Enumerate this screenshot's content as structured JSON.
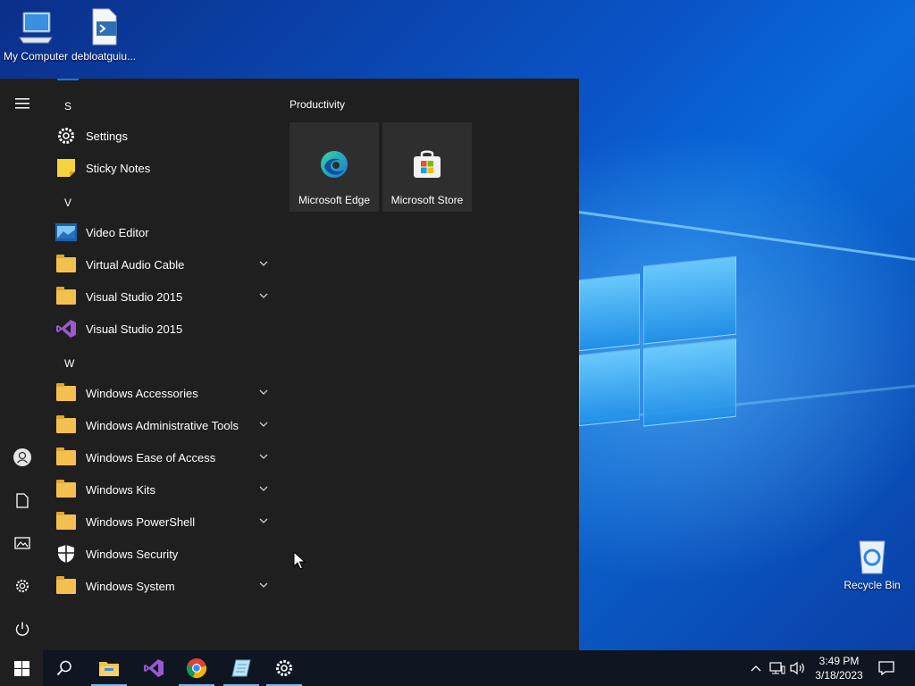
{
  "desktop": {
    "icons": [
      {
        "label": "My Computer"
      },
      {
        "label": "debloatguiu..."
      },
      {
        "label": "Recycle Bin"
      }
    ]
  },
  "start_menu": {
    "groups": [
      {
        "letter": "S",
        "items": [
          {
            "label": "Settings",
            "icon": "gear-icon",
            "expandable": false
          },
          {
            "label": "Sticky Notes",
            "icon": "sticky-notes-icon",
            "expandable": false
          }
        ]
      },
      {
        "letter": "V",
        "items": [
          {
            "label": "Video Editor",
            "icon": "video-editor-icon",
            "expandable": false
          },
          {
            "label": "Virtual Audio Cable",
            "icon": "folder-icon",
            "expandable": true
          },
          {
            "label": "Visual Studio 2015",
            "icon": "folder-icon",
            "expandable": true
          },
          {
            "label": "Visual Studio 2015",
            "icon": "visual-studio-icon",
            "expandable": false
          }
        ]
      },
      {
        "letter": "W",
        "items": [
          {
            "label": "Windows Accessories",
            "icon": "folder-icon",
            "expandable": true
          },
          {
            "label": "Windows Administrative Tools",
            "icon": "folder-icon",
            "expandable": true
          },
          {
            "label": "Windows Ease of Access",
            "icon": "folder-icon",
            "expandable": true
          },
          {
            "label": "Windows Kits",
            "icon": "folder-icon",
            "expandable": true
          },
          {
            "label": "Windows PowerShell",
            "icon": "folder-icon",
            "expandable": true
          },
          {
            "label": "Windows Security",
            "icon": "shield-icon",
            "expandable": false
          },
          {
            "label": "Windows System",
            "icon": "folder-icon",
            "expandable": true
          }
        ]
      }
    ],
    "tiles_group": "Productivity",
    "tiles": [
      {
        "label": "Microsoft Edge",
        "icon": "edge-icon"
      },
      {
        "label": "Microsoft Store",
        "icon": "store-icon"
      }
    ]
  },
  "taskbar": {
    "clock_time": "3:49 PM",
    "clock_date": "3/18/2023",
    "pinned": [
      "file-explorer-icon",
      "visual-studio-icon",
      "chrome-icon",
      "notepad-icon",
      "settings-icon"
    ]
  },
  "colors": {
    "accent": "#0078d7",
    "menu_bg": "#1f1f1f",
    "tile_bg": "#2e2e2e",
    "folder": "#f3c04f"
  }
}
